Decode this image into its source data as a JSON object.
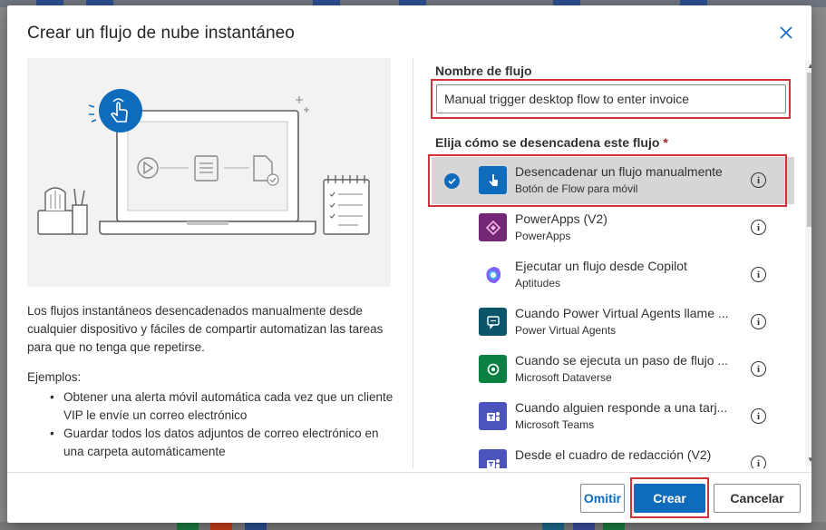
{
  "dialog": {
    "title": "Crear un flujo de nube instantáneo",
    "close_icon": "close-icon",
    "description": "Los flujos instantáneos desencadenados manualmente desde cualquier dispositivo y fáciles de compartir automatizan las tareas para que no tenga que repetirse.",
    "examples_label": "Ejemplos:",
    "examples": [
      "Obtener una alerta móvil automática cada vez que un cliente VIP le envíe un correo electrónico",
      "Guardar todos los datos adjuntos de correo electrónico en una carpeta automáticamente"
    ]
  },
  "form": {
    "name_label": "Nombre de flujo",
    "name_value": "Manual trigger desktop flow to enter invoice",
    "trigger_label": "Elija cómo se desencadena este flujo",
    "required_mark": "*"
  },
  "triggers": [
    {
      "title": "Desencadenar un flujo manualmente",
      "subtitle": "Botón de Flow para móvil",
      "selected": true,
      "icon": "hand-tap-icon",
      "color": "#0f6cbd"
    },
    {
      "title": "PowerApps (V2)",
      "subtitle": "PowerApps",
      "selected": false,
      "icon": "powerapps-icon",
      "color": "#742774"
    },
    {
      "title": "Ejecutar un flujo desde Copilot",
      "subtitle": "Aptitudes",
      "selected": false,
      "icon": "copilot-icon",
      "color": "#ffffff"
    },
    {
      "title": "Cuando Power Virtual Agents llame ...",
      "subtitle": "Power Virtual Agents",
      "selected": false,
      "icon": "virtual-agents-icon",
      "color": "#0b556a"
    },
    {
      "title": "Cuando se ejecuta un paso de flujo ...",
      "subtitle": "Microsoft Dataverse",
      "selected": false,
      "icon": "dataverse-icon",
      "color": "#088142"
    },
    {
      "title": "Cuando alguien responde a una tarj...",
      "subtitle": "Microsoft Teams",
      "selected": false,
      "icon": "teams-icon",
      "color": "#4b53bc"
    },
    {
      "title": "Desde el cuadro de redacción (V2)",
      "subtitle": "",
      "selected": false,
      "icon": "teams-icon",
      "color": "#4b53bc"
    }
  ],
  "info_glyph": "i",
  "buttons": {
    "skip": "Omitir",
    "create": "Crear",
    "cancel": "Cancelar"
  },
  "colors": {
    "accent": "#0f6cbd",
    "highlight_outline": "#d13438"
  }
}
